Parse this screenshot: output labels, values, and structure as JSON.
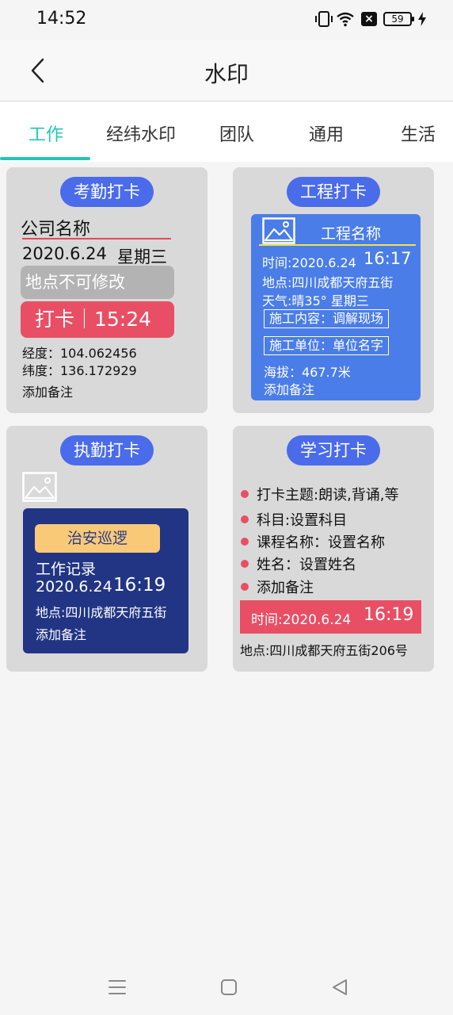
{
  "status": {
    "time": "14:52",
    "battery": "59"
  },
  "header": {
    "title": "水印"
  },
  "tabs": [
    {
      "label": "工作",
      "active": true
    },
    {
      "label": "经纬水印"
    },
    {
      "label": "团队"
    },
    {
      "label": "通用"
    },
    {
      "label": "生活"
    }
  ],
  "cards": {
    "attendance": {
      "title": "考勤打卡",
      "company": "公司名称",
      "date": "2020.6.24",
      "weekday": "星期三",
      "location": "地点不可修改",
      "punch": "打卡｜15:24",
      "longitude": "经度：104.062456",
      "latitude": "纬度：136.172929",
      "note": "添加备注"
    },
    "engineering": {
      "title": "工程打卡",
      "project": "工程名称",
      "time_label": "时间:2020.6.24",
      "time_value": "16:17",
      "location": "地点:四川成都天府五街",
      "weather": "天气:晴35°  星期三",
      "content": "施工内容：调解现场",
      "unit": "施工单位：单位名字",
      "altitude": "海拔：467.7米",
      "note": "添加备注"
    },
    "duty": {
      "title": "执勤打卡",
      "tag": "治安巡逻",
      "record": "工作记录",
      "date": "2020.6.24",
      "time": "16:19",
      "location": "地点:四川成都天府五街",
      "note": "添加备注"
    },
    "study": {
      "title": "学习打卡",
      "items": [
        "打卡主题:朗读,背诵,等",
        "科目:设置科目",
        "课程名称：设置名称",
        "姓名：设置姓名",
        "添加备注"
      ],
      "time_label": "时间:2020.6.24",
      "time_value": "16:19",
      "location": "地点:四川成都天府五街206号"
    }
  },
  "colors": {
    "accent": "#1fc7b4",
    "pill": "#4a6bea",
    "red": "#e84f64",
    "blue_panel": "#4a7de8",
    "navy_panel": "#223584"
  }
}
